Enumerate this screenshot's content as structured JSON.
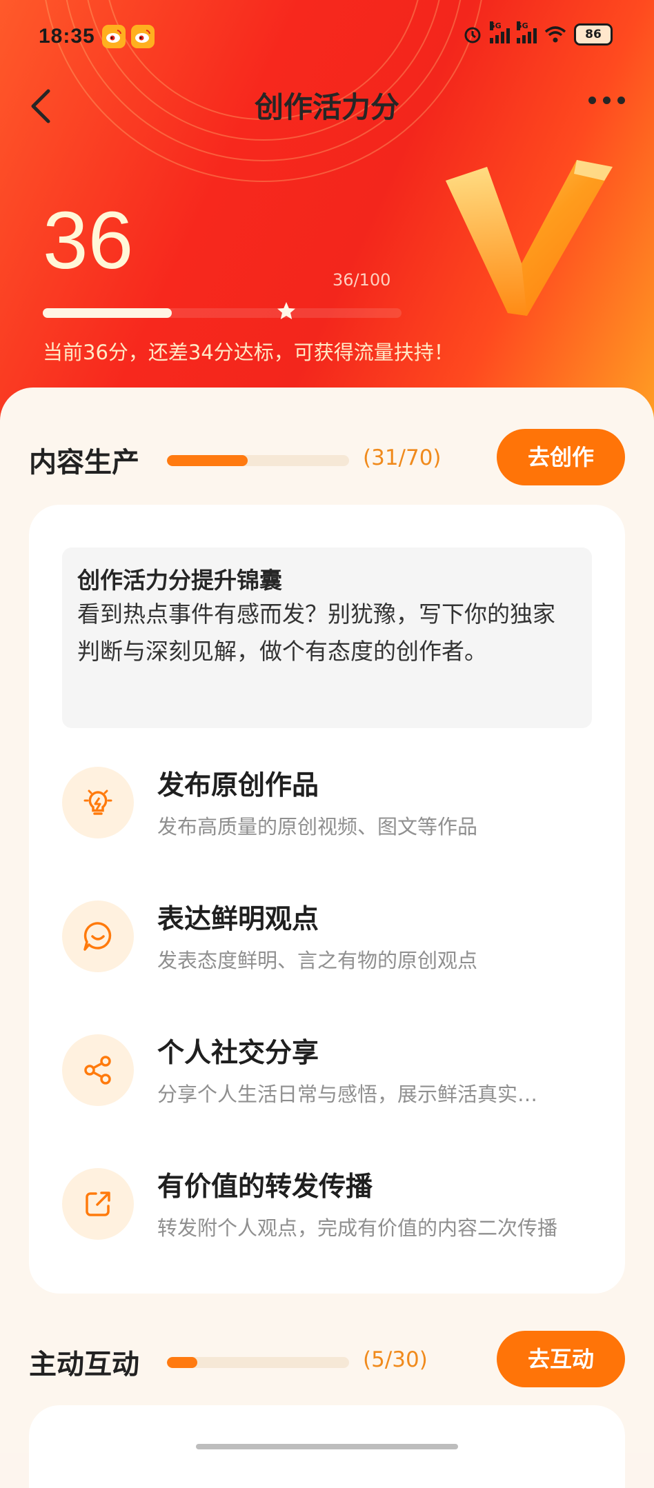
{
  "status_bar": {
    "time": "18:35",
    "battery": "86",
    "network_1": "5G",
    "network_2": "5G"
  },
  "nav": {
    "title": "创作活力分"
  },
  "score": {
    "value": "36",
    "ratio": "36/100",
    "progress_fraction": 0.36,
    "message": "当前36分，还差34分达标，可获得流量扶持！"
  },
  "sections": {
    "content": {
      "title": "内容生产",
      "count": "(31/70)",
      "progress_fraction": 0.443,
      "button": "去创作",
      "tip": {
        "title": "创作活力分提升锦囊",
        "body": "看到热点事件有感而发？别犹豫，写下你的独家判断与深刻见解，做个有态度的创作者。"
      },
      "items": [
        {
          "icon": "lightbulb-icon",
          "title": "发布原创作品",
          "desc": "发布高质量的原创视频、图文等作品"
        },
        {
          "icon": "chat-smile-icon",
          "title": "表达鲜明观点",
          "desc": "发表态度鲜明、言之有物的原创观点"
        },
        {
          "icon": "share-icon",
          "title": "个人社交分享",
          "desc": "分享个人生活日常与感悟，展示鲜活真实…"
        },
        {
          "icon": "forward-icon",
          "title": "有价值的转发传播",
          "desc": "转发附个人观点，完成有价值的内容二次传播"
        }
      ]
    },
    "interaction": {
      "title": "主动互动",
      "count": "(5/30)",
      "progress_fraction": 0.167,
      "button": "去互动"
    }
  },
  "colors": {
    "accent": "#ff7408",
    "hero_red": "#f3261c",
    "hero_orange": "#ffa224"
  }
}
